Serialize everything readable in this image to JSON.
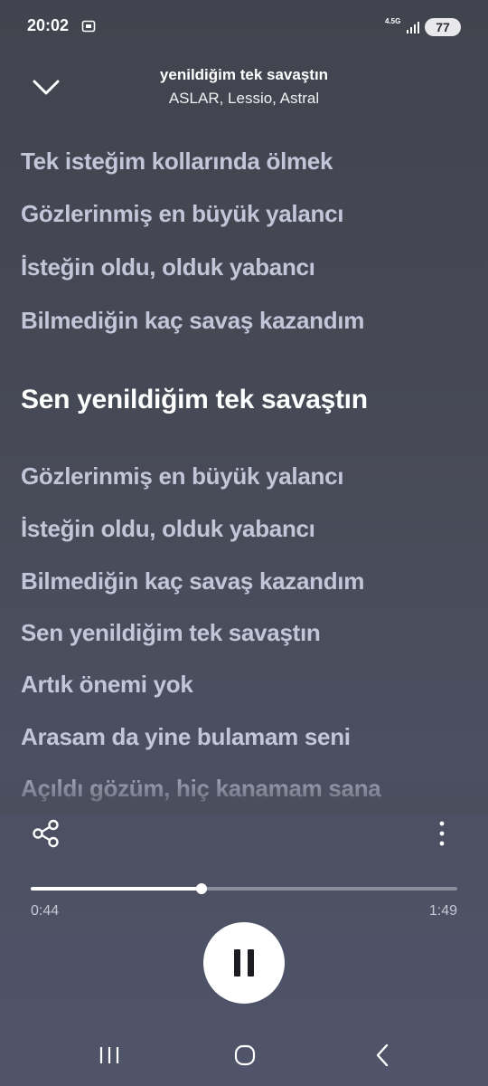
{
  "status_bar": {
    "time": "20:02",
    "network": "4.5G",
    "battery": "77"
  },
  "player": {
    "title": "yenildiğim tek savaştın",
    "artists": "ASLAR, Lessio, Astral",
    "lyrics": [
      {
        "text": "Tek isteğim kollarında ölmek",
        "current": false
      },
      {
        "text": "Gözlerinmiş en büyük yalancı",
        "current": false
      },
      {
        "text": "İsteğin oldu, olduk yabancı",
        "current": false
      },
      {
        "text": "Bilmediğin kaç savaş kazandım",
        "current": false
      },
      {
        "text": "Sen yenildiğim tek savaştın",
        "current": true
      },
      {
        "text": "Gözlerinmiş en büyük yalancı",
        "current": false
      },
      {
        "text": "İsteğin oldu, olduk yabancı",
        "current": false
      },
      {
        "text": "Bilmediğin kaç savaş kazandım",
        "current": false
      },
      {
        "text": "Sen yenildiğim tek savaştın",
        "current": false
      },
      {
        "text": "Artık önemi yok",
        "current": false
      },
      {
        "text": "Arasam da yine bulamam seni",
        "current": false
      },
      {
        "text": "Açıldı gözüm, hiç kanamam sana",
        "current": false
      }
    ],
    "elapsed": "0:44",
    "total": "1:49",
    "progress_fraction": 0.4,
    "state": "playing"
  },
  "icons": {
    "collapse": "chevron-down-icon",
    "share": "share-icon",
    "more": "more-vertical-icon",
    "pause": "pause-icon"
  },
  "colors": {
    "background_top": "#41434e",
    "background_bottom": "#50546a",
    "lyric_inactive": "#c3c6d9",
    "lyric_active": "#ffffff"
  }
}
